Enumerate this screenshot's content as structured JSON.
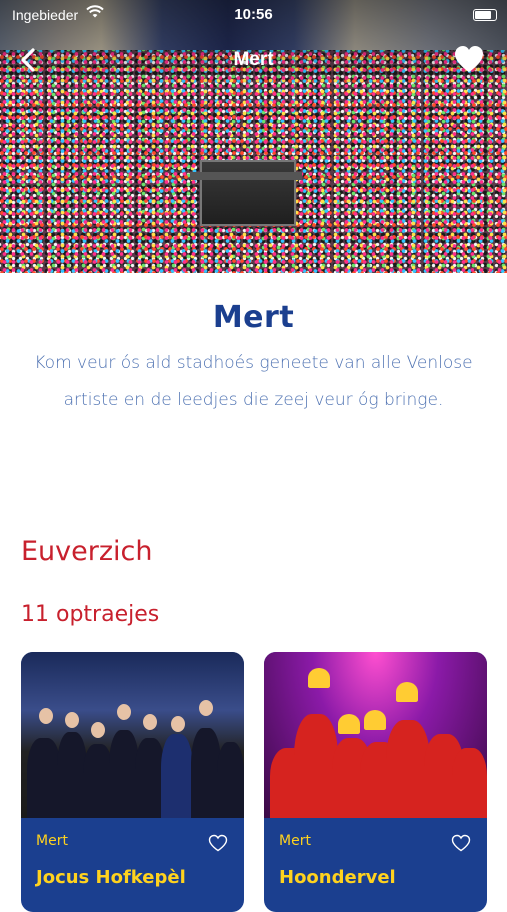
{
  "status_bar": {
    "carrier": "Ingebieder",
    "time": "10:56"
  },
  "nav": {
    "title": "Mert"
  },
  "intro": {
    "title": "Mert",
    "text": "Kom veur ós ald stadhoés geneete van alle Venlose artiste en de leedjes die zeej veur óg bringe."
  },
  "overview": {
    "title": "Euverzich",
    "count_label": "11 optraejes"
  },
  "cards": [
    {
      "tag": "Mert",
      "name": "Jocus Hofkepèl"
    },
    {
      "tag": "Mert",
      "name": "Hoondervel"
    }
  ],
  "colors": {
    "brand_blue": "#1b3f8f",
    "accent_red": "#c8202d",
    "accent_yellow": "#ffd21e"
  },
  "icons": {
    "back": "chevron-left-icon",
    "favorite": "heart-icon",
    "wifi": "wifi-icon",
    "battery": "battery-icon"
  }
}
